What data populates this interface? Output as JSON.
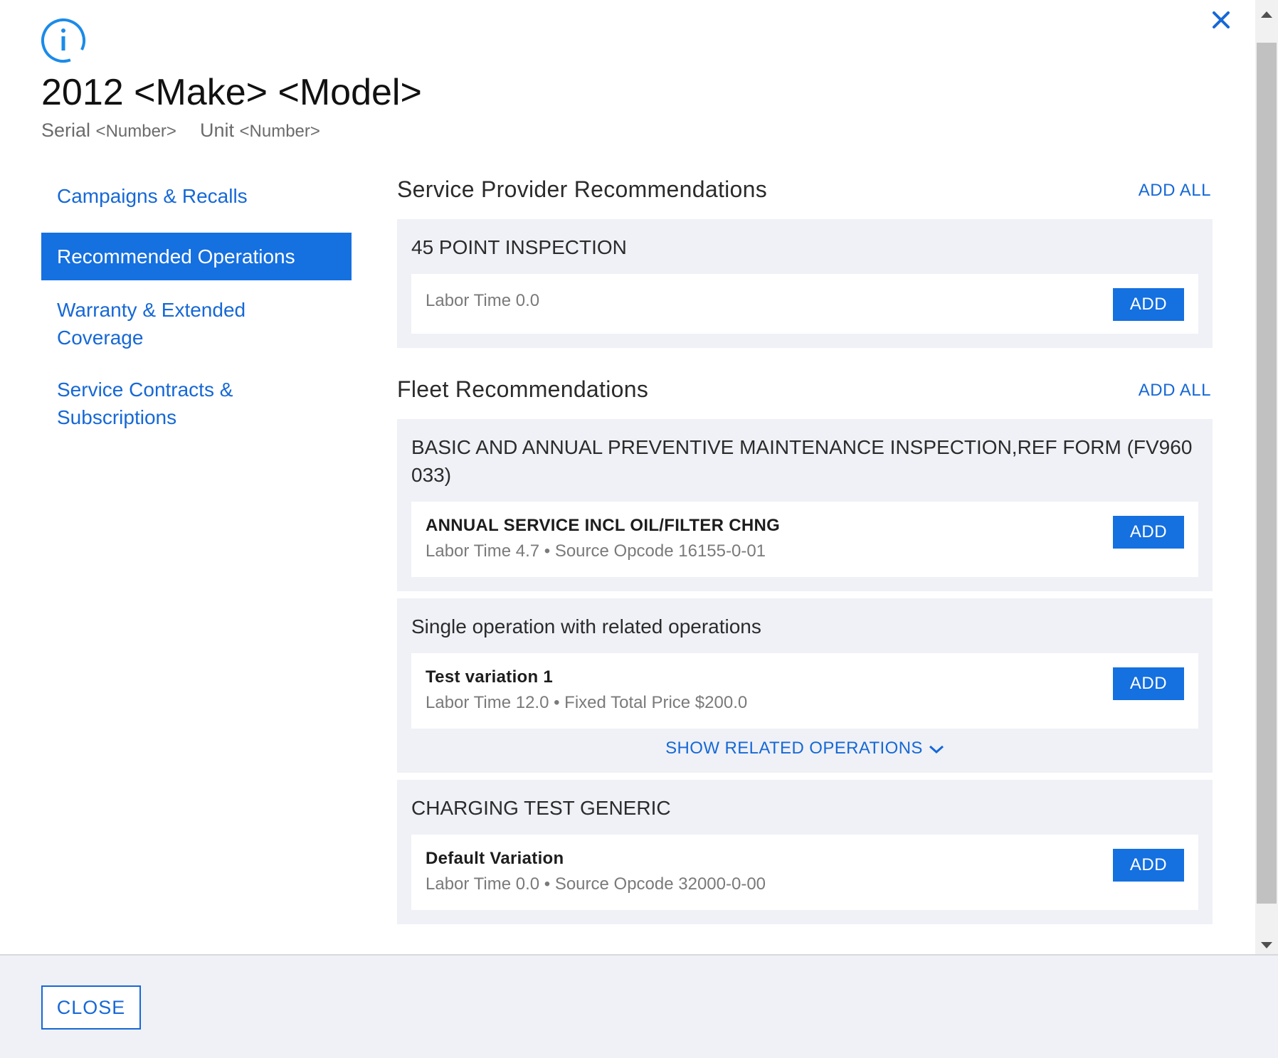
{
  "header": {
    "info_icon": "info-icon",
    "close_icon": "close-icon",
    "title": "2012 <Make> <Model>",
    "serial_label": "Serial",
    "serial_value": "<Number>",
    "unit_label": "Unit",
    "unit_value": "<Number>"
  },
  "sidebar": {
    "items": [
      {
        "label": "Campaigns & Recalls",
        "active": false
      },
      {
        "label": "Recommended Operations",
        "active": true
      },
      {
        "label": "Warranty & Extended Coverage",
        "active": false
      },
      {
        "label": "Service Contracts & Subscriptions",
        "active": false
      }
    ]
  },
  "sections": [
    {
      "title": "Service Provider Recommendations",
      "add_all_label": "ADD ALL",
      "groups": [
        {
          "title": "45 POINT INSPECTION",
          "operations": [
            {
              "name": "",
              "meta": "Labor Time 0.0",
              "add_label": "ADD"
            }
          ]
        }
      ]
    },
    {
      "title": "Fleet Recommendations",
      "add_all_label": "ADD ALL",
      "groups": [
        {
          "title": "BASIC AND ANNUAL PREVENTIVE MAINTENANCE INSPECTION,REF FORM (FV960 033)",
          "operations": [
            {
              "name": "ANNUAL SERVICE INCL OIL/FILTER CHNG",
              "meta": "Labor Time 4.7 • Source Opcode 16155-0-01",
              "add_label": "ADD"
            }
          ]
        },
        {
          "title": "Single operation with related operations",
          "operations": [
            {
              "name": "Test variation 1",
              "meta": "Labor Time 12.0 • Fixed Total Price $200.0",
              "add_label": "ADD"
            }
          ],
          "show_related_label": "SHOW RELATED OPERATIONS",
          "show_related_icon": "chevron-down-icon"
        },
        {
          "title": "CHARGING TEST GENERIC",
          "operations": [
            {
              "name": "Default Variation",
              "meta": "Labor Time 0.0 • Source Opcode 32000-0-00",
              "add_label": "ADD"
            }
          ]
        }
      ]
    }
  ],
  "footer": {
    "close_label": "CLOSE"
  },
  "colors": {
    "accent": "#1570e0",
    "link": "#1668d6",
    "group_bg": "#eff1f6",
    "muted_text": "#7a7a7a"
  }
}
